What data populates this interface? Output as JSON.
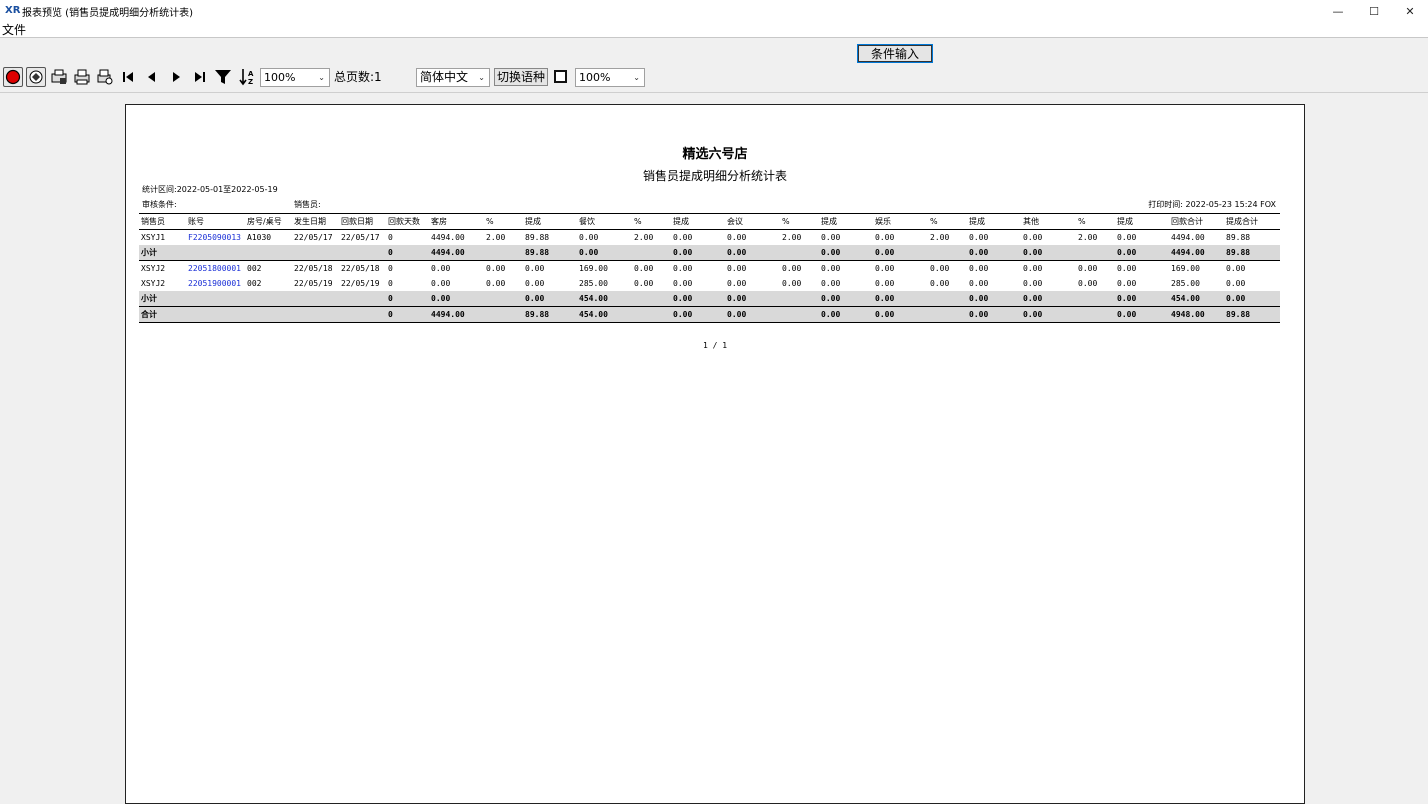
{
  "window": {
    "title": "报表预览 (销售员提成明细分析统计表)",
    "logo": "XR",
    "min": "—",
    "max": "☐",
    "close": "✕"
  },
  "menu": {
    "file": "文件"
  },
  "condition_button": "条件输入",
  "toolbar": {
    "zoom1": "100%",
    "total_pages_label": "总页数:1",
    "language": "简体中文",
    "switch_lang": "切换语种",
    "zoom2": "100%"
  },
  "report": {
    "title": "精选六号店",
    "subtitle": "销售员提成明细分析统计表",
    "period": "统计区间:2022-05-01至2022-05-19",
    "audit": "审核条件:",
    "salesman": "销售员:",
    "print_time": "打印时间: 2022-05-23 15:24 FOX",
    "headers": [
      "销售员",
      "账号",
      "房号/桌号",
      "发生日期",
      "回款日期",
      "回款天数",
      "客房",
      "%",
      "提成",
      "餐饮",
      "%",
      "提成",
      "会议",
      "%",
      "提成",
      "娱乐",
      "%",
      "提成",
      "其他",
      "%",
      "提成",
      "回款合计",
      "提成合计"
    ],
    "rows": [
      {
        "type": "data",
        "cells": [
          "XSYJ1",
          "F2205090013",
          "A1030",
          "22/05/17",
          "22/05/17",
          "0",
          "4494.00",
          "2.00",
          "89.88",
          "0.00",
          "2.00",
          "0.00",
          "0.00",
          "2.00",
          "0.00",
          "0.00",
          "2.00",
          "0.00",
          "0.00",
          "2.00",
          "0.00",
          "4494.00",
          "89.88"
        ]
      },
      {
        "type": "sub",
        "cells": [
          "小计",
          "",
          "",
          "",
          "",
          "0",
          "4494.00",
          "",
          "89.88",
          "0.00",
          "",
          "0.00",
          "0.00",
          "",
          "0.00",
          "0.00",
          "",
          "0.00",
          "0.00",
          "",
          "0.00",
          "4494.00",
          "89.88"
        ]
      },
      {
        "type": "data",
        "cells": [
          "XSYJ2",
          "22051800001",
          "002",
          "22/05/18",
          "22/05/18",
          "0",
          "0.00",
          "0.00",
          "0.00",
          "169.00",
          "0.00",
          "0.00",
          "0.00",
          "0.00",
          "0.00",
          "0.00",
          "0.00",
          "0.00",
          "0.00",
          "0.00",
          "0.00",
          "169.00",
          "0.00"
        ]
      },
      {
        "type": "data",
        "cells": [
          "XSYJ2",
          "22051900001",
          "002",
          "22/05/19",
          "22/05/19",
          "0",
          "0.00",
          "0.00",
          "0.00",
          "285.00",
          "0.00",
          "0.00",
          "0.00",
          "0.00",
          "0.00",
          "0.00",
          "0.00",
          "0.00",
          "0.00",
          "0.00",
          "0.00",
          "285.00",
          "0.00"
        ]
      },
      {
        "type": "sub",
        "cells": [
          "小计",
          "",
          "",
          "",
          "",
          "0",
          "0.00",
          "",
          "0.00",
          "454.00",
          "",
          "0.00",
          "0.00",
          "",
          "0.00",
          "0.00",
          "",
          "0.00",
          "0.00",
          "",
          "0.00",
          "454.00",
          "0.00"
        ]
      },
      {
        "type": "grand",
        "cells": [
          "合计",
          "",
          "",
          "",
          "",
          "0",
          "4494.00",
          "",
          "89.88",
          "454.00",
          "",
          "0.00",
          "0.00",
          "",
          "0.00",
          "0.00",
          "",
          "0.00",
          "0.00",
          "",
          "0.00",
          "4948.00",
          "89.88"
        ]
      }
    ],
    "pager": "1 / 1"
  }
}
